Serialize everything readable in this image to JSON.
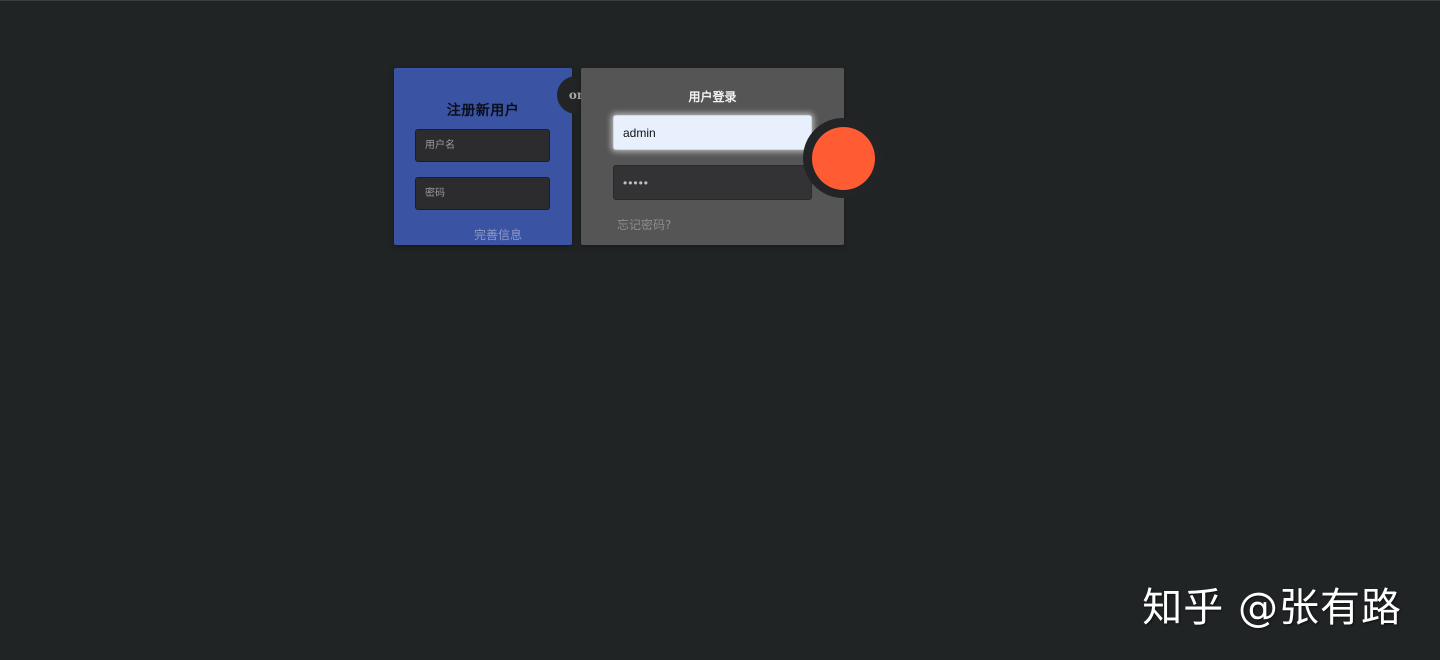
{
  "register": {
    "title": "注册新用户",
    "username_placeholder": "用户名",
    "password_placeholder": "密码",
    "complete_info_label": "完善信息"
  },
  "divider": {
    "or_label": "or"
  },
  "login": {
    "title": "用户登录",
    "username_value": "admin",
    "password_value": "•••••",
    "forgot_password_label": "忘记密码?"
  },
  "colors": {
    "background": "#212425",
    "register_panel": "#3a54a3",
    "login_panel": "#555556",
    "submit_accent": "#ff5c33"
  },
  "watermark": {
    "text": "知乎 @张有路"
  }
}
